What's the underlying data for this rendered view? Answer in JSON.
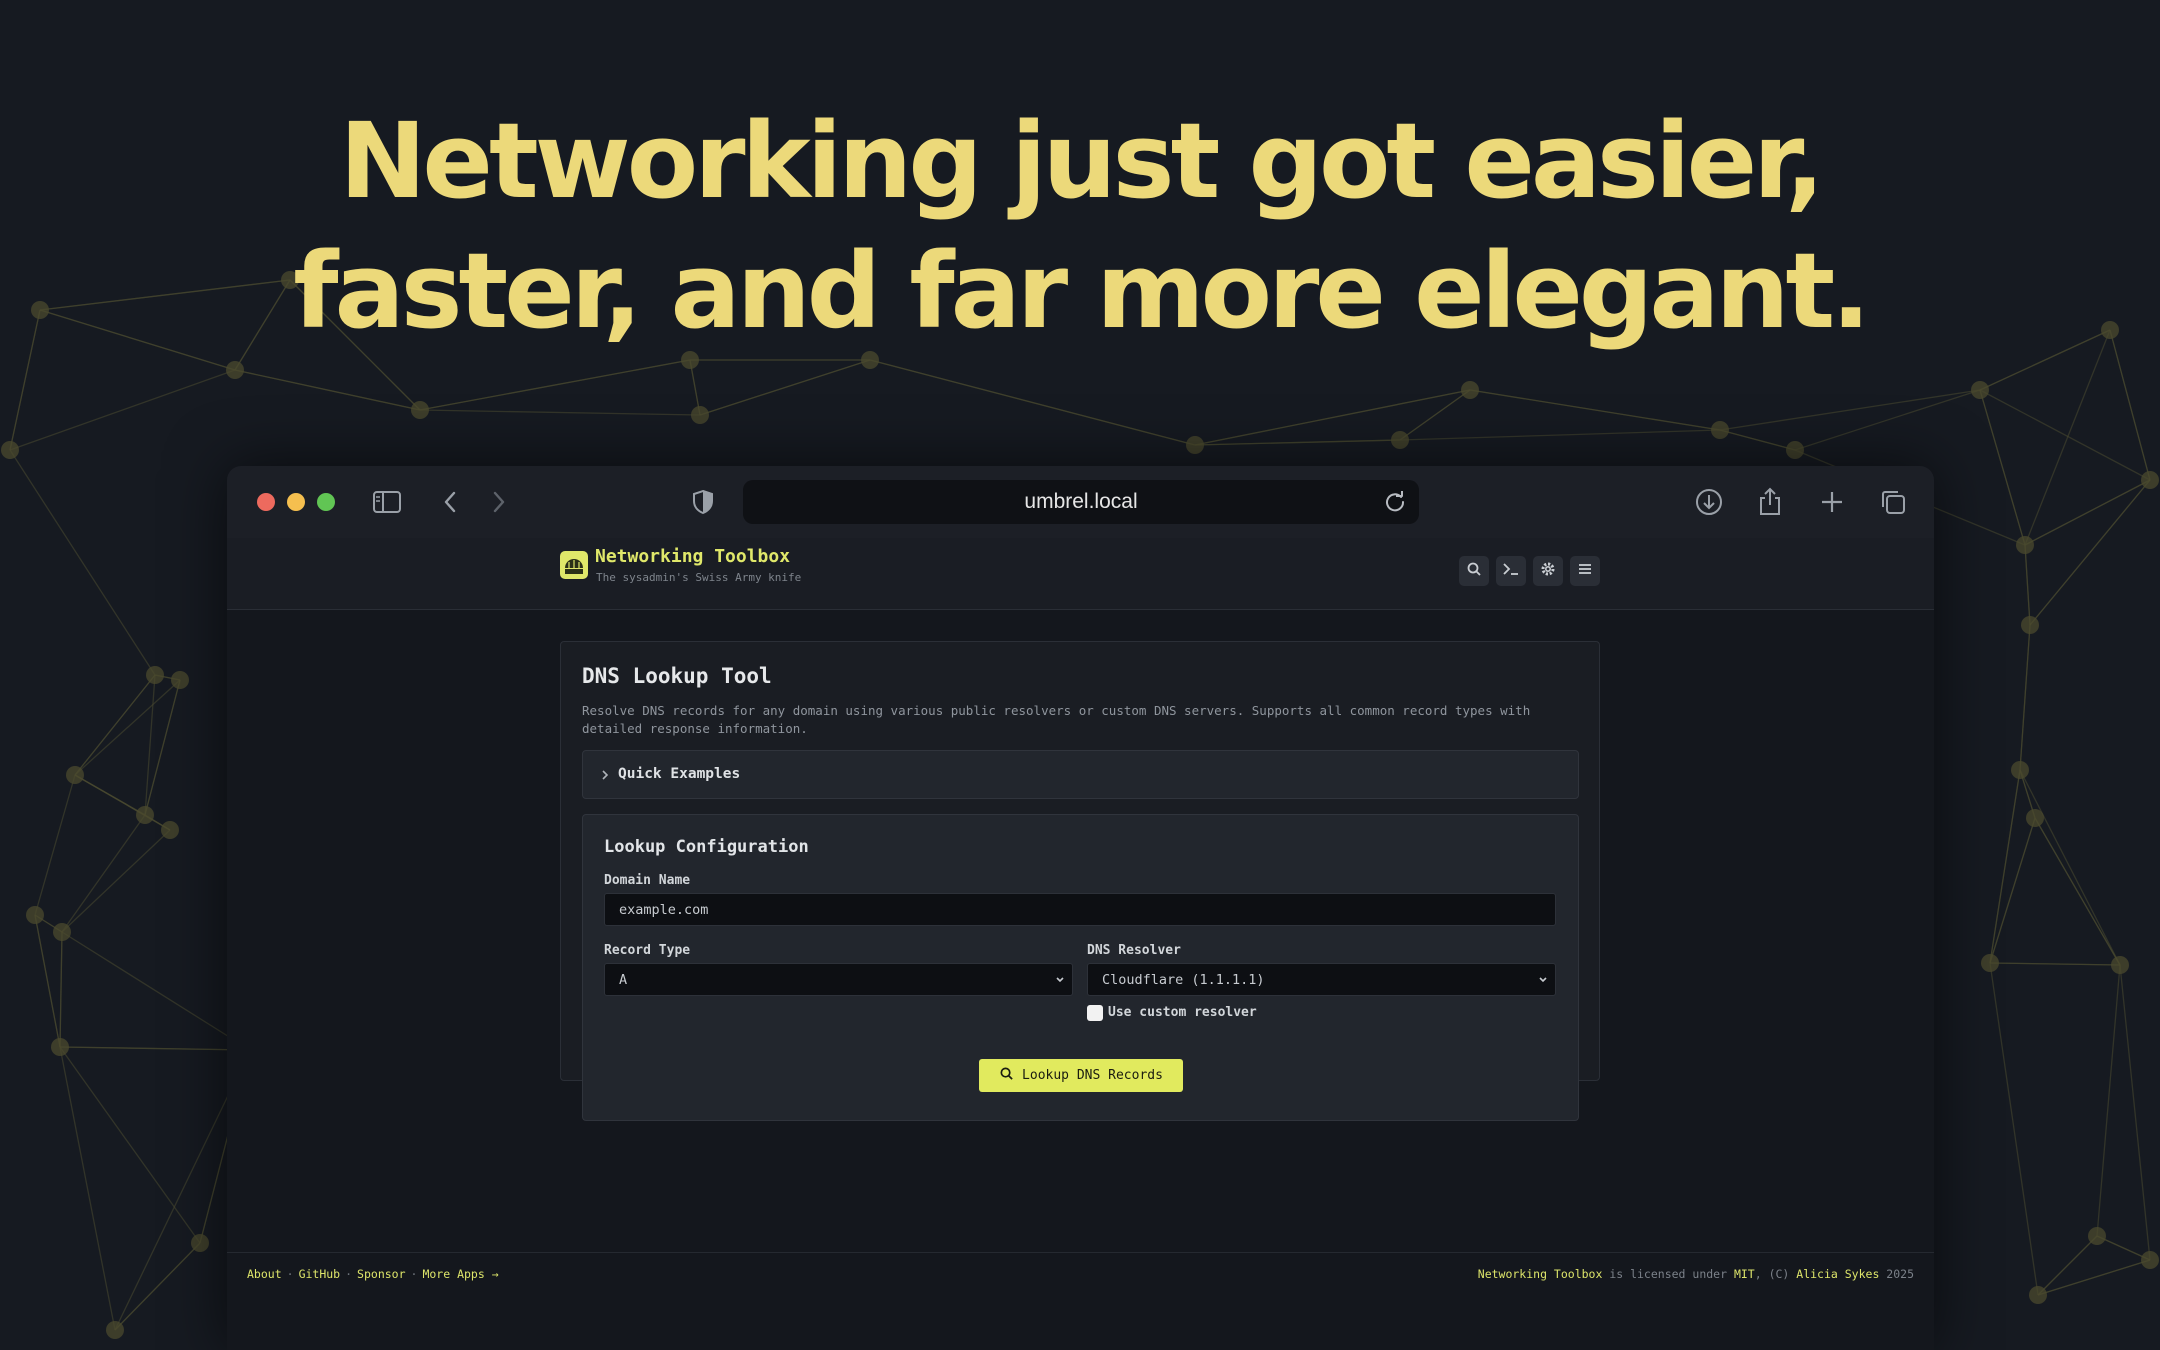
{
  "headline": {
    "line1": "Networking just got easier,",
    "line2": "faster, and far more elegant."
  },
  "browser": {
    "url": "umbrel.local",
    "icons": [
      "sidebar-icon",
      "back-icon",
      "forward-icon",
      "shield-icon",
      "reload-icon",
      "download-icon",
      "share-icon",
      "new-tab-icon",
      "tabs-overview-icon"
    ]
  },
  "app": {
    "title": "Networking Toolbox",
    "subtitle": "The sysadmin's Swiss Army knife",
    "header_icons": [
      "search-icon",
      "terminal-icon",
      "gear-icon",
      "menu-icon"
    ]
  },
  "tool": {
    "title": "DNS Lookup Tool",
    "description": "Resolve DNS records for any domain using various public resolvers or custom DNS servers. Supports all common record types with detailed response information.",
    "quick_examples_label": "Quick Examples",
    "config": {
      "title": "Lookup Configuration",
      "domain_label": "Domain Name",
      "domain_value": "example.com",
      "record_type_label": "Record Type",
      "record_type_value": "A",
      "resolver_label": "DNS Resolver",
      "resolver_value": "Cloudflare (1.1.1.1)",
      "custom_resolver_label": "Use custom resolver",
      "custom_resolver_checked": false,
      "submit_label": "Lookup DNS Records"
    }
  },
  "footer": {
    "links": [
      "About",
      "GitHub",
      "Sponsor",
      "More Apps →"
    ],
    "separator": "·",
    "license": {
      "app_name": "Networking Toolbox",
      "text1": " is licensed under ",
      "license_name": "MIT",
      "text2": ", (C) ",
      "author": "Alicia Sykes",
      "year": " 2025"
    }
  },
  "colors": {
    "headline": "#ecd97a",
    "accent": "#e1ea5e",
    "background": "#161a21"
  }
}
